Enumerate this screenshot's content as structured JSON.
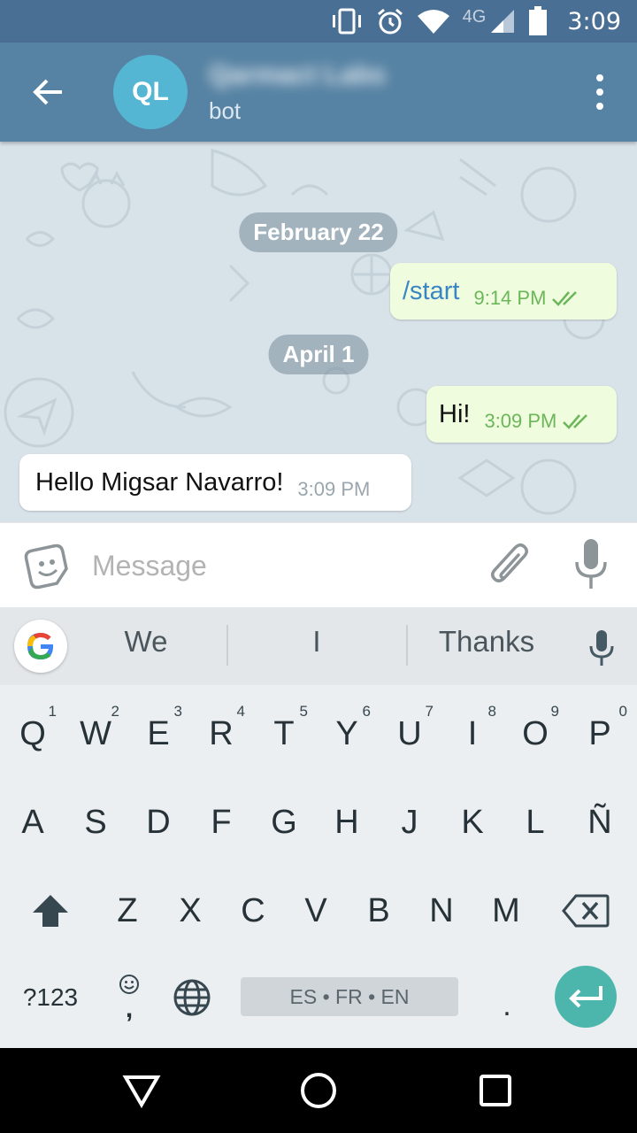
{
  "status_bar": {
    "time": "3:09",
    "network": "4G",
    "icons": [
      "vibrate-icon",
      "alarm-icon",
      "wifi-icon",
      "signal-icon",
      "battery-icon"
    ]
  },
  "header": {
    "avatar_initials": "QL",
    "title": "Qarmact Labs",
    "subtitle": "bot",
    "back_icon": "arrow-back-icon",
    "menu_icon": "more-vert-icon"
  },
  "messages": [
    {
      "type": "date",
      "text": "February 22"
    },
    {
      "type": "outgoing",
      "text": "/start",
      "time": "9:14 PM",
      "read": true
    },
    {
      "type": "date",
      "text": "April 1"
    },
    {
      "type": "outgoing",
      "text": "Hi!",
      "time": "3:09 PM",
      "read": true
    },
    {
      "type": "incoming",
      "text": "Hello Migsar Navarro!",
      "time": "3:09 PM"
    }
  ],
  "composer": {
    "placeholder": "Message",
    "value": ""
  },
  "keyboard": {
    "suggestions": [
      "We",
      "I",
      "Thanks"
    ],
    "row1": [
      {
        "key": "Q",
        "hint": "1"
      },
      {
        "key": "W",
        "hint": "2"
      },
      {
        "key": "E",
        "hint": "3"
      },
      {
        "key": "R",
        "hint": "4"
      },
      {
        "key": "T",
        "hint": "5"
      },
      {
        "key": "Y",
        "hint": "6"
      },
      {
        "key": "U",
        "hint": "7"
      },
      {
        "key": "I",
        "hint": "8"
      },
      {
        "key": "O",
        "hint": "9"
      },
      {
        "key": "P",
        "hint": "0"
      }
    ],
    "row2": [
      "A",
      "S",
      "D",
      "F",
      "G",
      "H",
      "J",
      "K",
      "L",
      "Ñ"
    ],
    "row3": [
      "Z",
      "X",
      "C",
      "V",
      "B",
      "N",
      "M"
    ],
    "symbols_label": "?123",
    "comma": ",",
    "period": ".",
    "language_label": "ES • FR • EN"
  },
  "colors": {
    "status_bar": "#4a6f94",
    "app_bar": "#5682a3",
    "outgoing_bubble": "#effdde",
    "incoming_bubble": "#ffffff",
    "enter_key": "#4db6ac"
  }
}
